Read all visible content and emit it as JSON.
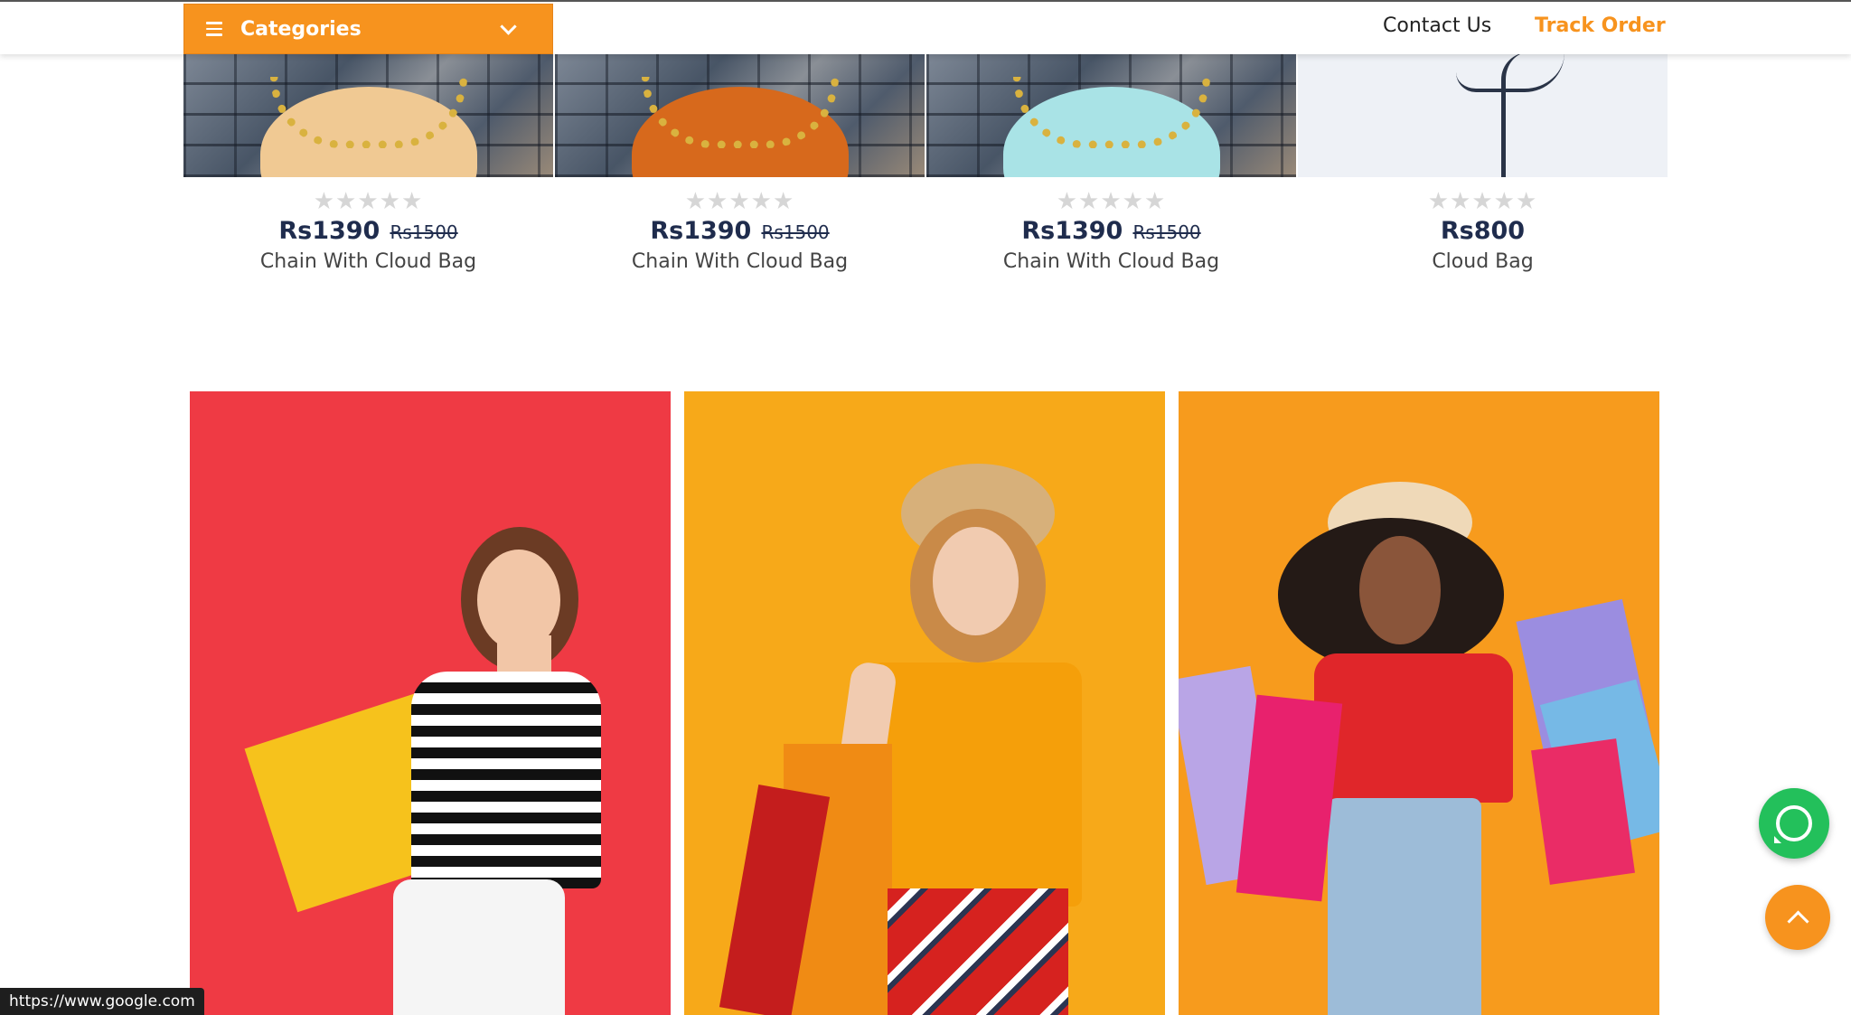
{
  "header": {
    "categories_label": "Categories",
    "contact_label": "Contact Us",
    "track_label": "Track Order"
  },
  "products": [
    {
      "stars": "★★★★★",
      "price": "Rs1390",
      "old_price": "Rs1500",
      "name": "Chain With Cloud Bag"
    },
    {
      "stars": "★★★★★",
      "price": "Rs1390",
      "old_price": "Rs1500",
      "name": "Chain With Cloud Bag"
    },
    {
      "stars": "★★★★★",
      "price": "Rs1390",
      "old_price": "Rs1500",
      "name": "Chain With Cloud Bag"
    },
    {
      "stars": "★★★★★",
      "price": "Rs800",
      "old_price": "",
      "name": "Cloud Bag"
    }
  ],
  "colors": {
    "accent": "#f7931e",
    "price": "#1f2c4d",
    "whatsapp": "#23c05b"
  },
  "icons": {
    "menu": "menu-icon",
    "chevron": "chevron-down-icon",
    "whatsapp": "whatsapp-icon",
    "scroll_top": "chevron-up-icon"
  },
  "status_url": "https://www.google.com"
}
